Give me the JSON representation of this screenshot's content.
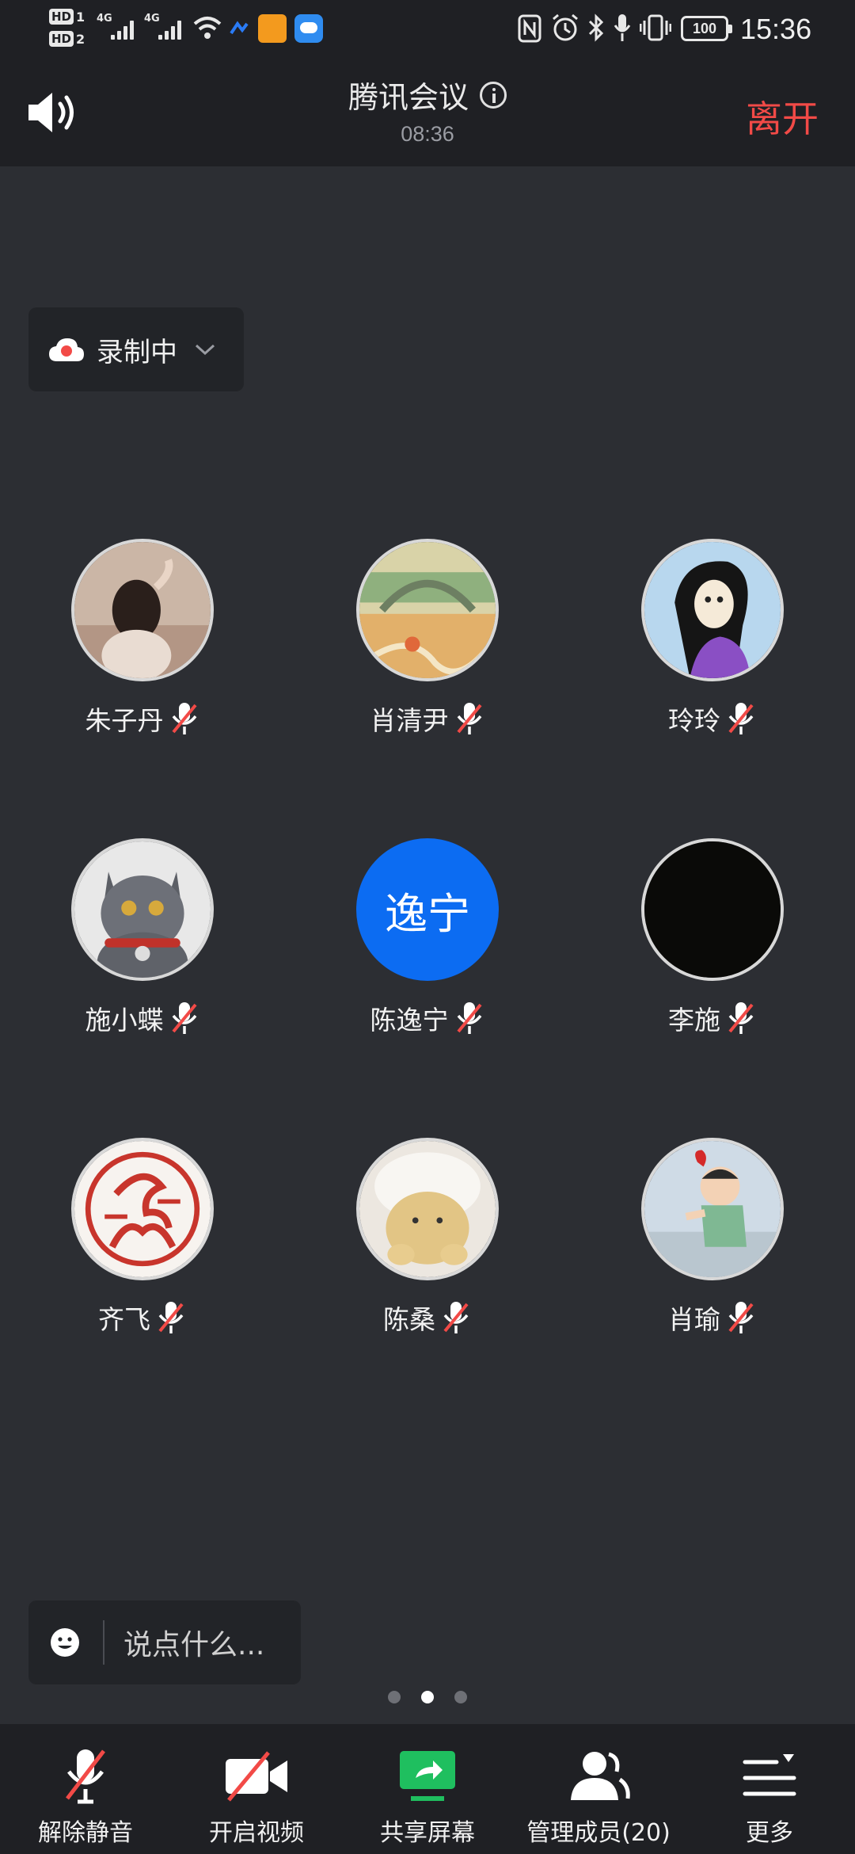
{
  "status_bar": {
    "hd1": "HD",
    "hd1_num": "1",
    "hd2": "HD",
    "hd2_num": "2",
    "net1": "4G",
    "net2": "4G",
    "battery": "100",
    "time": "15:36"
  },
  "header": {
    "title": "腾讯会议",
    "timer": "08:36",
    "leave_label": "离开"
  },
  "recording": {
    "label": "录制中"
  },
  "participants": [
    {
      "name": "朱子丹",
      "avatar": "photo-girl-icon"
    },
    {
      "name": "肖清尹",
      "avatar": "bridge-painting-icon"
    },
    {
      "name": "玲玲",
      "avatar": "cartoon-girl-icon"
    },
    {
      "name": "施小蝶",
      "avatar": "cat-icon"
    },
    {
      "name": "陈逸宁",
      "avatar_text": "逸宁"
    },
    {
      "name": "李施",
      "avatar": "black-avatar-icon"
    },
    {
      "name": "齐飞",
      "avatar": "red-seal-icon"
    },
    {
      "name": "陈桑",
      "avatar": "plush-toy-icon"
    },
    {
      "name": "肖瑜",
      "avatar": "cartoon-boy-icon"
    }
  ],
  "chat": {
    "placeholder": "说点什么..."
  },
  "pager": {
    "total": 3,
    "active": 2
  },
  "toolbar": {
    "unmute": "解除静音",
    "video": "开启视频",
    "share": "共享屏幕",
    "members": "管理成员(20)",
    "more": "更多"
  },
  "colors": {
    "background": "#2c2e33",
    "bar": "#1f2024",
    "leave": "#f24a47",
    "mute_red": "#f24a47",
    "share_green": "#1fbf5f",
    "avatar_blue": "#0c6cf2"
  }
}
